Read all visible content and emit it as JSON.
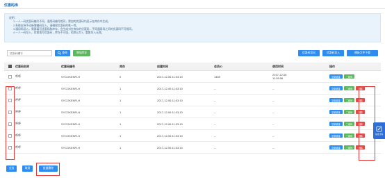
{
  "page": {
    "title": "优惠码库"
  },
  "notice": {
    "title": "说明：",
    "lines": [
      "1.一人一码优惠码编号不同，通用码编号相同，需加的优惠码均显示在库存中生成。",
      "2.系统支持手动新增编码导入，请确保优惠码的唯一性。",
      "3.通用码导入，需要填写优惠码和库存，会生成对应库存的优惠码，不同通用码之间的优惠码不可相同。",
      "4.一人一码导入，仅需填写优惠码，库存不可填，也默认为1，重复导入无效。"
    ]
  },
  "search": {
    "placeholder": "优惠码编号",
    "query_label": "查询",
    "add_label": "增加库存"
  },
  "toolbar": {
    "export_label": "优惠码导出",
    "import_label": "优惠码导入",
    "template_label": "模板文件下载"
  },
  "table": {
    "headers": {
      "name": "优惠码名称",
      "code": "优惠码编号",
      "stock": "库存",
      "created": "创建时间",
      "member": "会员ID",
      "used": "使用时间",
      "op": "操作"
    },
    "op_labels": {
      "copy": "复制链接",
      "qr": "二维码",
      "delete": "删除"
    },
    "rows": [
      {
        "name": "呼呼",
        "code": "SYCOKENFLH",
        "stock": "0",
        "created": "2017-12-06 11:03:10",
        "member": "1469",
        "used_date": "2017-12-06",
        "used_time": "11:05:56",
        "has_delete": false
      },
      {
        "name": "呼呼",
        "code": "SYCOKENFLH",
        "stock": "1",
        "created": "2017-12-06 11:03:10",
        "member": "--",
        "used_date": "--",
        "used_time": "",
        "has_delete": true
      },
      {
        "name": "呼呼",
        "code": "SYCOKENFLH",
        "stock": "1",
        "created": "2017-12-06 11:03:10",
        "member": "--",
        "used_date": "--",
        "used_time": "",
        "has_delete": true
      },
      {
        "name": "呼呼",
        "code": "SYCOKENFLH",
        "stock": "1",
        "created": "2017-12-06 11:03:10",
        "member": "--",
        "used_date": "--",
        "used_time": "",
        "has_delete": true
      },
      {
        "name": "呼呼",
        "code": "SYCOKENFLH",
        "stock": "1",
        "created": "2017-12-06 11:03:10",
        "member": "--",
        "used_date": "--",
        "used_time": "",
        "has_delete": true
      },
      {
        "name": "呼呼",
        "code": "SYCOKENFLH",
        "stock": "1",
        "created": "2017-12-06 11:03:10",
        "member": "--",
        "used_date": "--",
        "used_time": "",
        "has_delete": true
      },
      {
        "name": "呼呼",
        "code": "SYCOKENFLH",
        "stock": "1",
        "created": "2017-12-06 11:03:10",
        "member": "--",
        "used_date": "--",
        "used_time": "",
        "has_delete": true
      }
    ]
  },
  "footer": {
    "select_all_label": "全选",
    "cancel_label": "取消",
    "batch_delete_label": "批量删除"
  },
  "side_widget": {
    "label": "在线 咨询"
  },
  "colors": {
    "primary": "#2d8cf0",
    "success": "#5cb85c",
    "danger": "#e14b4b",
    "highlight": "#e53935"
  }
}
